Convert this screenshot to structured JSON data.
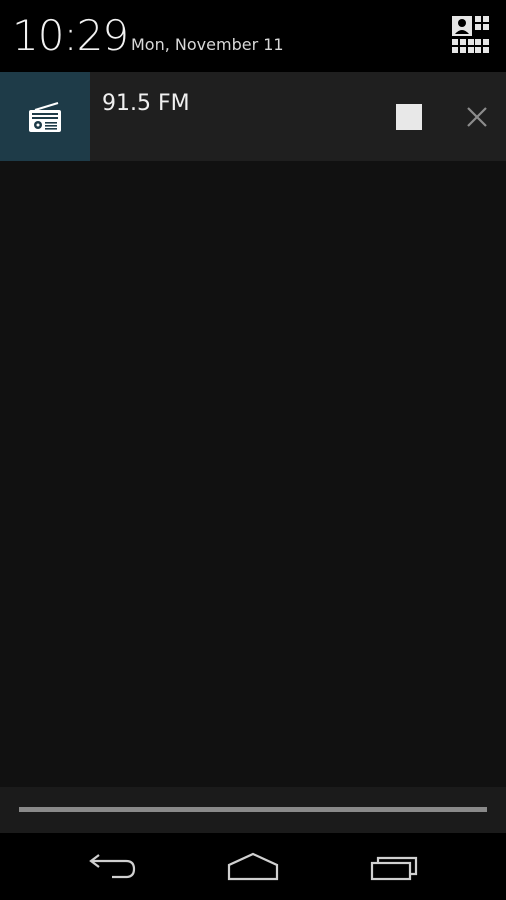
{
  "header": {
    "time": "10:29",
    "date": "Mon, November 11"
  },
  "notification": {
    "title": "91.5 FM",
    "icon": "radio-icon",
    "actions": {
      "stop": "stop-icon",
      "dismiss": "close-icon"
    }
  },
  "navbar": {
    "back": "back-icon",
    "home": "home-icon",
    "recents": "recents-icon"
  },
  "colors": {
    "icon_background": "#1e3b48",
    "notification_background": "#1f1f1f",
    "shade_background": "#111111"
  }
}
